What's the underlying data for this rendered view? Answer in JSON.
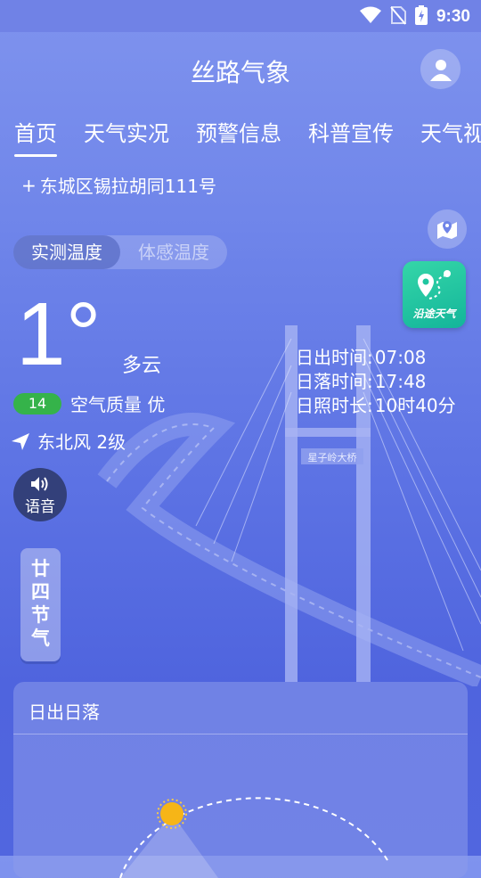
{
  "status_bar": {
    "time": "9:30"
  },
  "header": {
    "title": "丝路气象"
  },
  "tabs": [
    {
      "label": "首页",
      "active": true
    },
    {
      "label": "天气实况"
    },
    {
      "label": "预警信息"
    },
    {
      "label": "科普宣传"
    },
    {
      "label": "天气视"
    }
  ],
  "location": {
    "prefix": "+",
    "name": "东城区锡拉胡同111号"
  },
  "temp_toggle": {
    "measured": "实测温度",
    "feels_like": "体感温度"
  },
  "current": {
    "temperature": "1°",
    "weather": "多云",
    "aqi_value": "14",
    "aqi_text": "空气质量 优",
    "wind": "东北风 2级"
  },
  "voice": {
    "label": "语音"
  },
  "solar_terms": {
    "chars": [
      "廿",
      "四",
      "节",
      "气"
    ]
  },
  "route_weather": {
    "label": "沿途天气"
  },
  "sun": {
    "sunrise_label": "日出时间:",
    "sunrise": "07:08",
    "sunset_label": "日落时间:",
    "sunset": "17:48",
    "daylight_label": "日照时长:",
    "daylight": "10时40分"
  },
  "sun_card": {
    "title": "日出日落"
  },
  "bridge_sign": "星子岭大桥",
  "colors": {
    "aqi_good": "#35b34a",
    "route_card": "#1fc6a0",
    "sun": "#f6b517"
  }
}
